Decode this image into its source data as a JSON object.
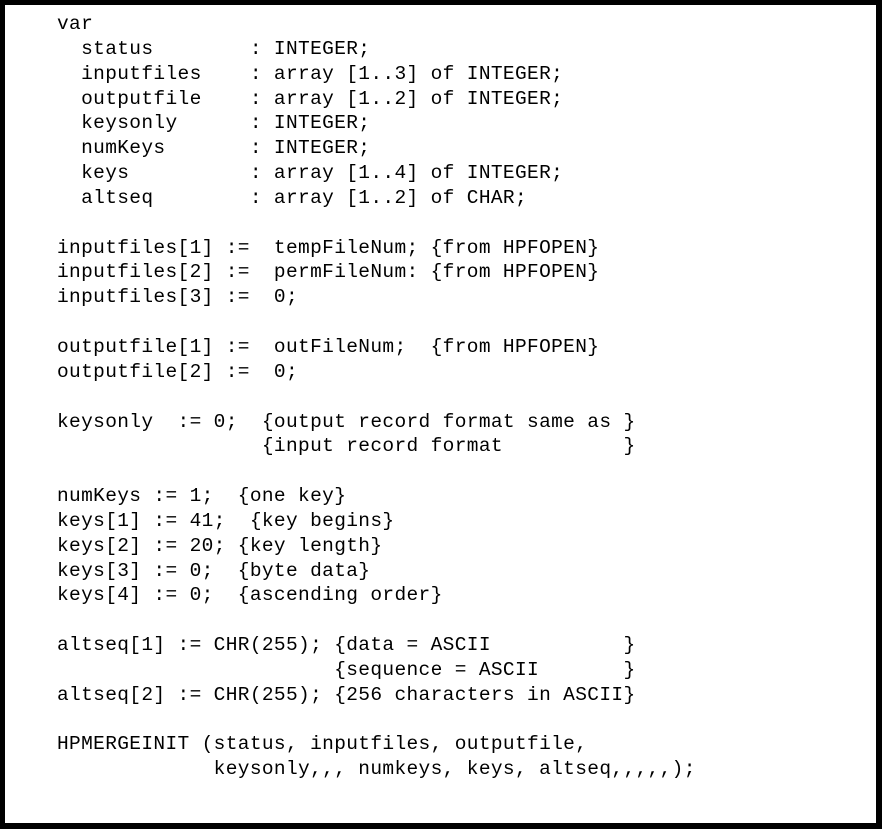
{
  "document": {
    "kind": "code-listing",
    "language": "Pascal",
    "border_color": "#000000",
    "background_color": "#ffffff",
    "text_color": "#000000"
  },
  "code": {
    "lines": [
      "var",
      "  status        : INTEGER;",
      "  inputfiles    : array [1..3] of INTEGER;",
      "  outputfile    : array [1..2] of INTEGER;",
      "  keysonly      : INTEGER;",
      "  numKeys       : INTEGER;",
      "  keys          : array [1..4] of INTEGER;",
      "  altseq        : array [1..2] of CHAR;",
      "",
      "inputfiles[1] :=  tempFileNum; {from HPFOPEN}",
      "inputfiles[2] :=  permFileNum: {from HPFOPEN}",
      "inputfiles[3] :=  0;",
      "",
      "outputfile[1] :=  outFileNum;  {from HPFOPEN}",
      "outputfile[2] :=  0;",
      "",
      "keysonly  := 0;  {output record format same as }",
      "                 {input record format          }",
      "",
      "numKeys := 1;  {one key}",
      "keys[1] := 41;  {key begins}",
      "keys[2] := 20; {key length}",
      "keys[3] := 0;  {byte data}",
      "keys[4] := 0;  {ascending order}",
      "",
      "altseq[1] := CHR(255); {data = ASCII           }",
      "                       {sequence = ASCII       }",
      "altseq[2] := CHR(255); {256 characters in ASCII}",
      "",
      "HPMERGEINIT (status, inputfiles, outputfile,",
      "             keysonly,,, numkeys, keys, altseq,,,,,);"
    ]
  }
}
